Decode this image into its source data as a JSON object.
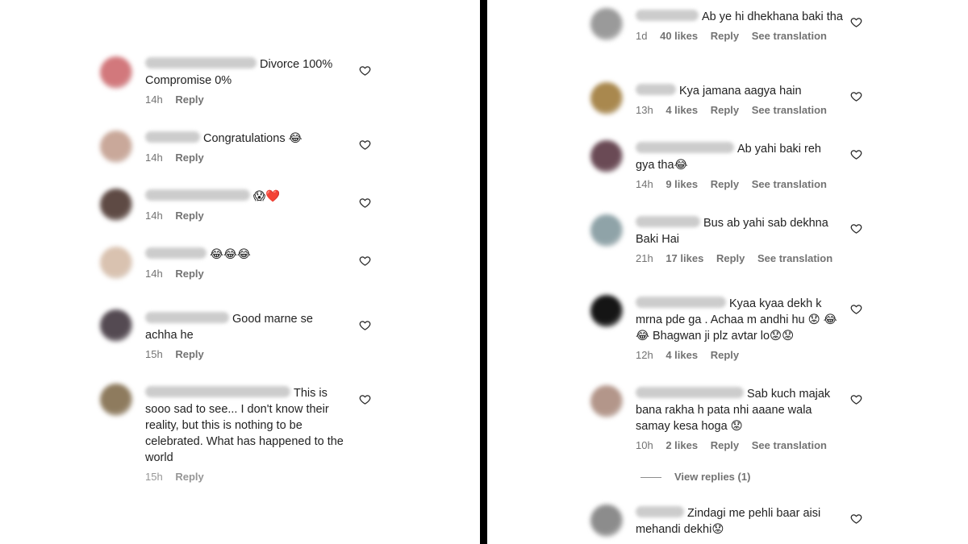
{
  "left_comments": [
    {
      "text": "Divorce 100%\nCompromise 0%",
      "time": "14h",
      "reply": "Reply",
      "avatar_color": "#d2787c"
    },
    {
      "text": "Congratulations 😂",
      "time": "14h",
      "reply": "Reply",
      "avatar_color": "#c9a89a"
    },
    {
      "text": "😱❤️",
      "time": "14h",
      "reply": "Reply",
      "avatar_color": "#5e4a44"
    },
    {
      "text": "😂😂😂",
      "time": "14h",
      "reply": "Reply",
      "avatar_color": "#d9c2b0"
    },
    {
      "text": "Good marne se achha he",
      "time": "15h",
      "reply": "Reply",
      "avatar_color": "#544a52"
    },
    {
      "text": "This is sooo sad to see... I don't know their reality, but this is nothing to be celebrated. What has happened to the world",
      "time": "15h",
      "reply": "Reply",
      "avatar_color": "#8e7b5e"
    }
  ],
  "right_comments": [
    {
      "text": "Ab ye hi dhekhana baki tha",
      "time": "1d",
      "likes": "40 likes",
      "reply": "Reply",
      "translate": "See translation",
      "avatar_color": "#9a9a9a"
    },
    {
      "text": "Kya jamana aagya hain",
      "time": "13h",
      "likes": "4 likes",
      "reply": "Reply",
      "translate": "See translation",
      "avatar_color": "#a9884e"
    },
    {
      "text": "Ab yahi baki reh gya tha😂",
      "time": "14h",
      "likes": "9 likes",
      "reply": "Reply",
      "translate": "See translation",
      "avatar_color": "#6a4a55"
    },
    {
      "text": "Bus ab yahi sab dekhna Baki Hai",
      "time": "21h",
      "likes": "17 likes",
      "reply": "Reply",
      "translate": "See translation",
      "avatar_color": "#8fa3a8"
    },
    {
      "text": "Kyaa kyaa dekh k mrna pde ga . Achaa m andhi hu 😟 😂😂 Bhagwan ji plz avtar lo😟😟",
      "time": "12h",
      "likes": "4 likes",
      "reply": "Reply",
      "translate": "",
      "avatar_color": "#151515"
    },
    {
      "text": "Sab kuch majak bana rakha h pata nhi aaane wala samay kesa hoga 😟",
      "time": "10h",
      "likes": "2 likes",
      "reply": "Reply",
      "translate": "See translation",
      "avatar_color": "#b3968a"
    },
    {
      "text": "Zindagi me pehli baar aisi mehandi dekhi😟",
      "time": "",
      "likes": "",
      "reply": "",
      "translate": "",
      "avatar_color": "#8c8c8c"
    }
  ],
  "view_replies": "View replies (1)",
  "icons": {
    "like": "heart-outline-icon"
  }
}
